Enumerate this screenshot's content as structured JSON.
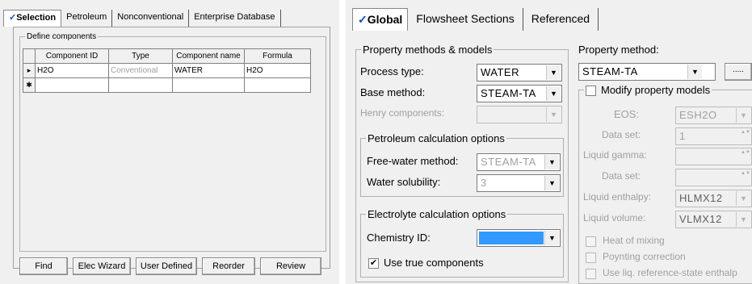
{
  "left": {
    "tabs": [
      "Selection",
      "Petroleum",
      "Nonconventional",
      "Enterprise Database"
    ],
    "check_mark": "✓",
    "group_label": "Define components",
    "table": {
      "headers": [
        "Component ID",
        "Type",
        "Component name",
        "Formula"
      ],
      "rows": [
        {
          "marker": "▸",
          "id": "H2O",
          "type": "Conventional",
          "name": "WATER",
          "formula": "H2O"
        },
        {
          "marker": "✱",
          "id": "",
          "type": "",
          "name": "",
          "formula": ""
        }
      ]
    },
    "buttons": [
      "Find",
      "Elec Wizard",
      "User Defined",
      "Reorder",
      "Review"
    ]
  },
  "right": {
    "check_mark": "✓",
    "tabs": [
      "Global",
      "Flowsheet Sections",
      "Referenced"
    ],
    "property_group": {
      "label": "Property methods & models",
      "process_type_label": "Process type:",
      "process_type_value": "WATER",
      "base_method_label": "Base method:",
      "base_method_value": "STEAM-TA",
      "henry_label": "Henry components:",
      "henry_value": ""
    },
    "petroleum_group": {
      "label": "Petroleum calculation options",
      "free_water_label": "Free-water method:",
      "free_water_value": "STEAM-TA",
      "solubility_label": "Water solubility:",
      "solubility_value": "3"
    },
    "electrolyte_group": {
      "label": "Electrolyte calculation options",
      "chemistry_label": "Chemistry ID:",
      "chemistry_value": "",
      "chemistry_color": "#3399ff",
      "true_components_label": "Use true components",
      "true_components_checked": "✔"
    },
    "property_method": {
      "label": "Property method:",
      "value": "STEAM-TA",
      "ellipsis": "....."
    },
    "modify_models": {
      "label": "Modify property models",
      "eos_label": "EOS:",
      "eos_value": "ESH2O",
      "dataset1_label": "Data set:",
      "dataset1_value": "1",
      "liquid_gamma_label": "Liquid gamma:",
      "liquid_gamma_value": "",
      "dataset2_label": "Data set:",
      "dataset2_value": "",
      "liquid_enthalpy_label": "Liquid enthalpy:",
      "liquid_enthalpy_value": "HLMX12",
      "liquid_volume_label": "Liquid volume:",
      "liquid_volume_value": "VLMX12",
      "heat_of_mixing": "Heat of mixing",
      "poynting": "Poynting correction",
      "use_liq_ref": "Use liq. reference-state enthalp"
    },
    "icons": {
      "dropdown": "▼",
      "spin": "▲▼"
    }
  }
}
